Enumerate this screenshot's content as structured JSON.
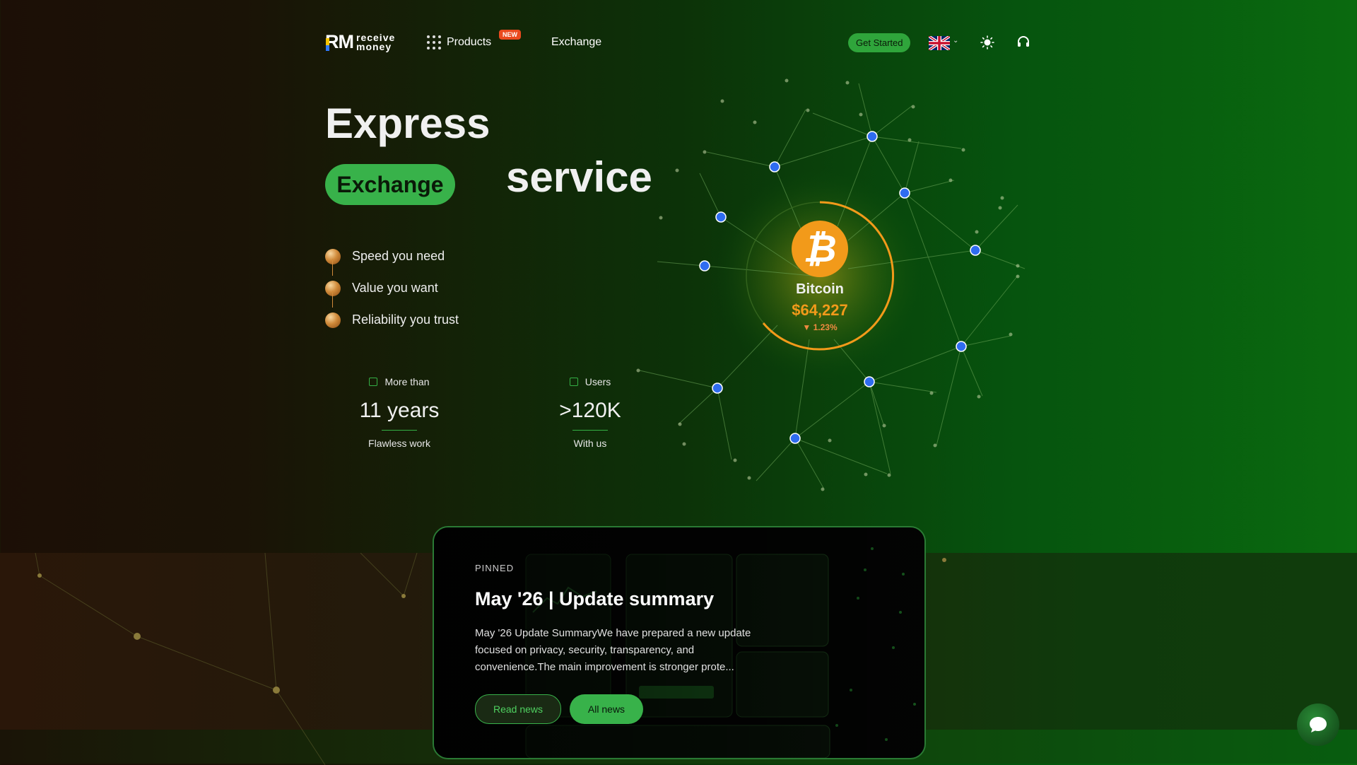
{
  "header": {
    "logo_mark": "RM",
    "logo_line1": "receive",
    "logo_line2": "money",
    "products_label": "Products",
    "new_badge": "NEW",
    "exchange_label": "Exchange",
    "get_started_label": "Get Started",
    "language_icon": "uk-flag-icon",
    "theme_icon": "sun-icon",
    "support_icon": "headset-icon"
  },
  "hero": {
    "title_word1": "Express",
    "title_pill": "Exchange",
    "title_word3": "service",
    "features": [
      "Speed you need",
      "Value you want",
      "Reliability you trust"
    ]
  },
  "stats": [
    {
      "label": "More than",
      "value": "11 years",
      "sub": "Flawless work"
    },
    {
      "label": "Users",
      "value": ">120K",
      "sub": "With us"
    }
  ],
  "ticker": {
    "name": "Bitcoin",
    "price": "$64,227",
    "change": "▼ 1.23%",
    "change_color": "#f08a40",
    "accent": "#f29a1a"
  },
  "news": {
    "pinned_label": "PINNED",
    "title": "May '26 | Update summary",
    "body": "May '26 Update SummaryWe have prepared a new update focused on privacy, security, transparency, and convenience.The main improvement is stronger prote...",
    "read_label": "Read news",
    "all_label": "All news"
  },
  "colors": {
    "brand_green": "#38b24a",
    "new_badge": "#ea4a1f"
  }
}
